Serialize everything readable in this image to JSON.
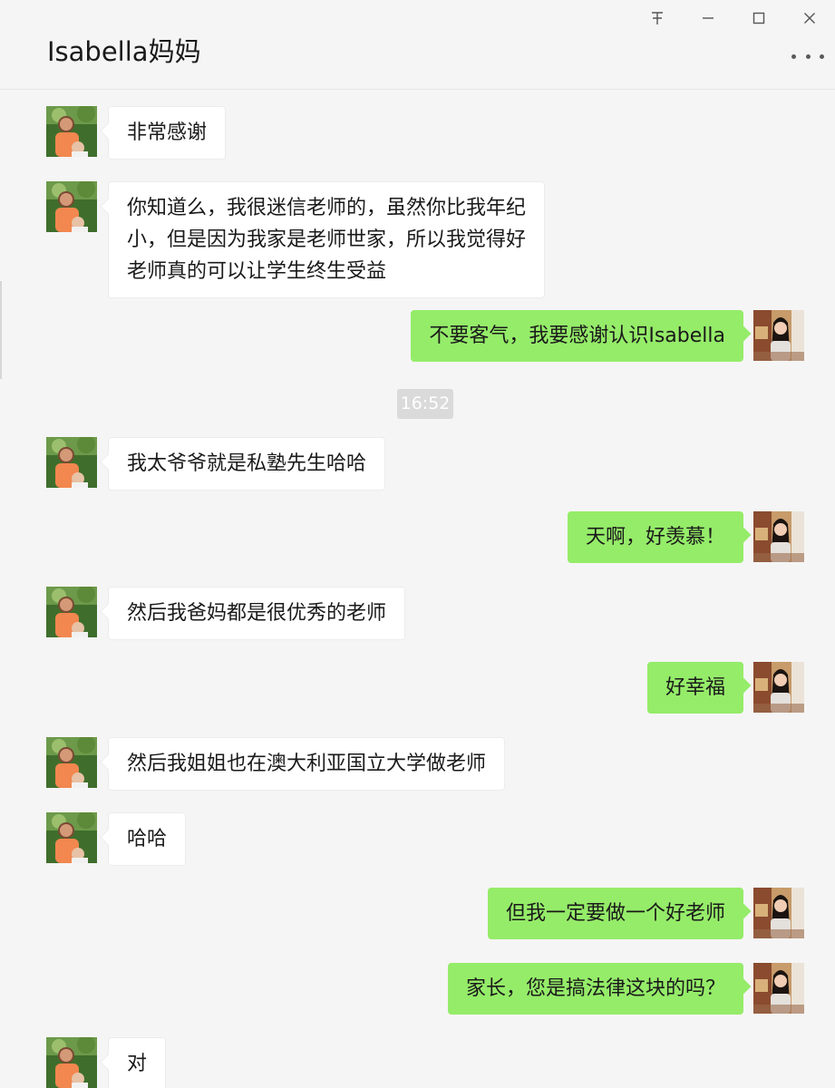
{
  "window": {
    "title": "Isabella妈妈",
    "controls": [
      "pin-icon",
      "minimize-icon",
      "maximize-icon",
      "close-icon"
    ],
    "more_icon": "more-dots-icon"
  },
  "colors": {
    "background": "#f5f5f5",
    "incoming_bubble": "#ffffff",
    "outgoing_bubble": "#95ec69",
    "timestamp_bg": "#dadada"
  },
  "messages": [
    {
      "from": "contact",
      "text": "非常感谢"
    },
    {
      "from": "contact",
      "text": "你知道么，我很迷信老师的，虽然你比我年纪\n小，但是因为我家是老师世家，所以我觉得好\n老师真的可以让学生终生受益"
    },
    {
      "from": "me",
      "text": "不要客气，我要感谢认识Isabella"
    },
    {
      "from": "contact",
      "text": "我太爷爷就是私塾先生哈哈"
    },
    {
      "from": "me",
      "text": "天啊，好羡慕！"
    },
    {
      "from": "contact",
      "text": "然后我爸妈都是很优秀的老师"
    },
    {
      "from": "me",
      "text": "好幸福"
    },
    {
      "from": "contact",
      "text": "然后我姐姐也在澳大利亚国立大学做老师"
    },
    {
      "from": "contact",
      "text": "哈哈"
    },
    {
      "from": "me",
      "text": "但我一定要做一个好老师"
    },
    {
      "from": "me",
      "text": "家长，您是搞法律这块的吗？"
    },
    {
      "from": "contact",
      "text": "对"
    }
  ],
  "timestamp": "16:52"
}
